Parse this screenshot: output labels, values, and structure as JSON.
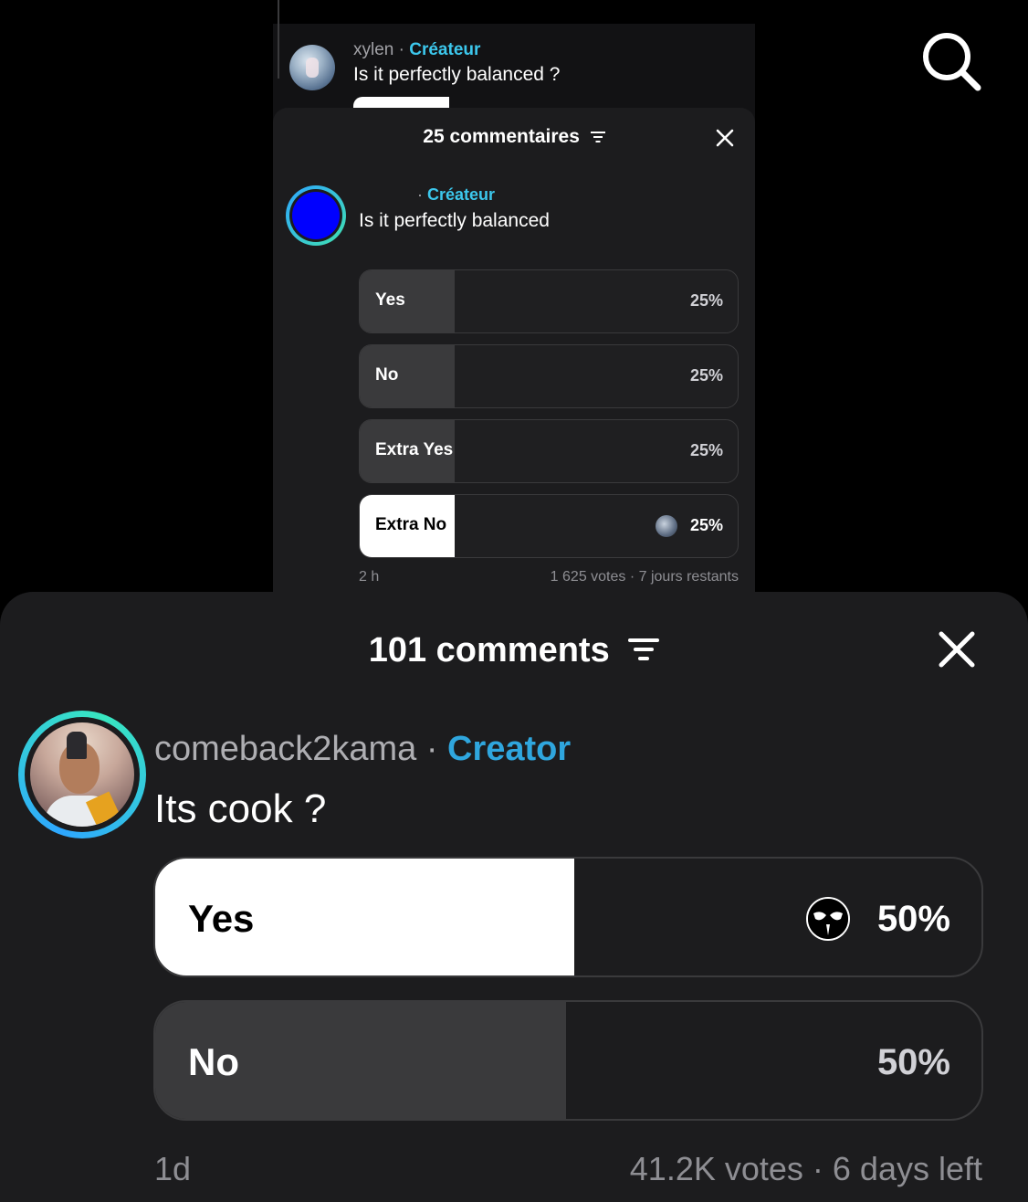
{
  "inner_screenshot": {
    "top_comment": {
      "username": "xylen",
      "separator": "·",
      "creator_label": "Créateur",
      "question": "Is it perfectly balanced ?"
    },
    "header": {
      "title": "25 commentaires"
    },
    "creator_label": "Créateur",
    "separator": "·",
    "question": "Is it perfectly balanced",
    "poll": [
      {
        "label": "Yes",
        "percent": "25%",
        "fill": 0.25,
        "selected": false
      },
      {
        "label": "No",
        "percent": "25%",
        "fill": 0.25,
        "selected": false
      },
      {
        "label": "Extra Yes",
        "percent": "25%",
        "fill": 0.25,
        "selected": false
      },
      {
        "label": "Extra No",
        "percent": "25%",
        "fill": 0.25,
        "selected": true
      }
    ],
    "time_ago": "2 h",
    "votes_info": "1 625 votes · 7 jours restants",
    "avatar_color": "#0000ff"
  },
  "main": {
    "header": {
      "title": "101 comments"
    },
    "username": "comeback2kama",
    "separator": "·",
    "creator_label": "Creator",
    "question": "Its cook ?",
    "poll": [
      {
        "label": "Yes",
        "percent": "50%",
        "fill": 0.5,
        "selected": true
      },
      {
        "label": "No",
        "percent": "50%",
        "fill": 0.5,
        "selected": false
      }
    ],
    "time_ago": "1d",
    "votes_info": "41.2K votes · 6 days left"
  },
  "colors": {
    "background": "#000000",
    "sheet": "#1c1c1e",
    "creator_accent": "#2fa6de",
    "option_fill": "#3a3a3c",
    "selected_fill": "#ffffff"
  },
  "icons": [
    "search-icon",
    "filter-icon",
    "close-icon"
  ]
}
